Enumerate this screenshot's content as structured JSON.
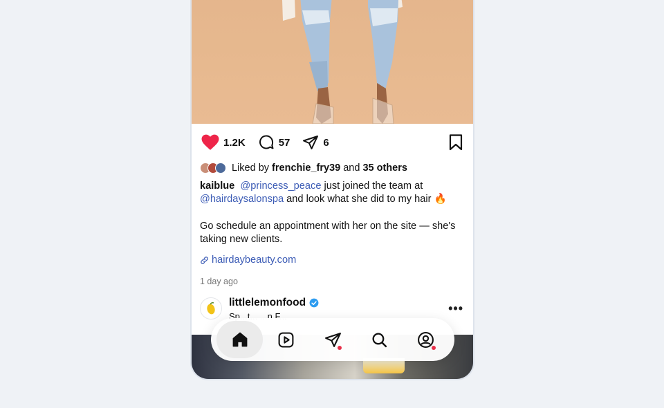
{
  "post": {
    "actions": {
      "likes_count": "1.2K",
      "comments_count": "57",
      "shares_count": "6",
      "liked": true,
      "like_color": "#ee2549"
    },
    "liked_by": {
      "prefix": "Liked by",
      "user": "frenchie_fry39",
      "conj": "and",
      "others": "35 others",
      "avatar_colors": [
        "#c98f78",
        "#b24b3c",
        "#4d6a9a"
      ]
    },
    "caption": {
      "author": "kaiblue",
      "mention1": "@princess_peace",
      "text1": "just joined the team at",
      "mention2": "@hairdaysalonspa",
      "text2": "and look what she did to my hair",
      "emoji": "🔥",
      "paragraph2": "Go schedule an appointment with her on the site — she's taking new clients."
    },
    "link": "hairdaybeauty.com",
    "time": "1 day ago"
  },
  "next_post": {
    "username": "littlelemonfood",
    "verified": true,
    "subtitle": "Sp...t... ...n F...",
    "more_label": "•••"
  },
  "tabbar": {
    "items": [
      {
        "name": "home",
        "active": true
      },
      {
        "name": "reels",
        "active": false
      },
      {
        "name": "messages",
        "active": false,
        "badge": true
      },
      {
        "name": "search",
        "active": false
      },
      {
        "name": "profile",
        "active": false,
        "badge": true
      }
    ],
    "badge_color": "#e8304a"
  },
  "colors": {
    "link": "#3b5bb5",
    "page_bg": "#eff2f6"
  }
}
